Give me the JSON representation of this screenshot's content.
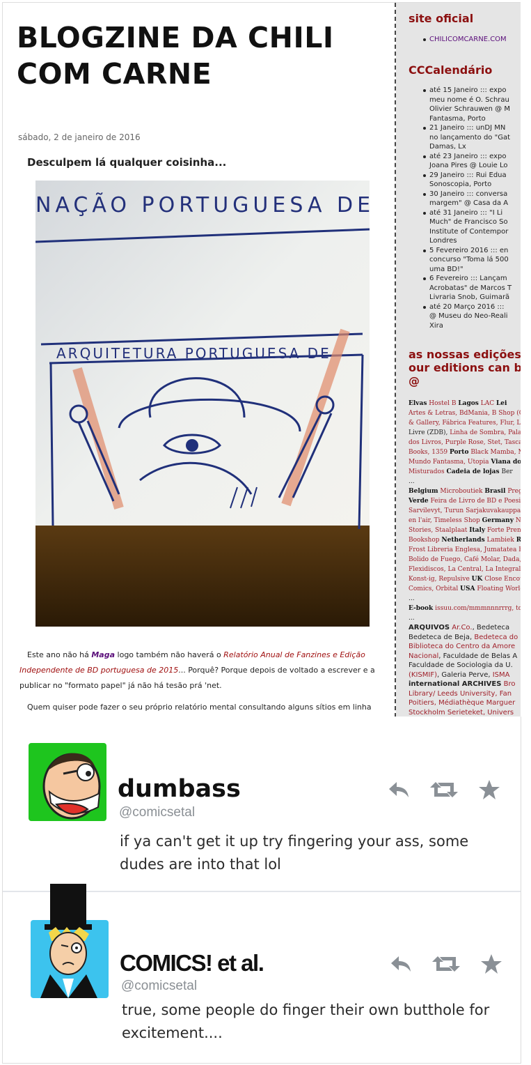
{
  "blog": {
    "title": "BLOGZINE DA CHILI COM CARNE",
    "date": "sábado, 2 de janeiro de 2016",
    "post_title": "Desculpem lá qualquer coisinha...",
    "drawing_text_top": "NAÇÃO PORTUGUESA DE",
    "drawing_text_mid": "ARQUITETURA PORTUGUESA DE",
    "body_p1_a": "Este ano não há ",
    "body_p1_maga": "Maga",
    "body_p1_b": " logo também não haverá o ",
    "body_p1_rel": "Relatório Anual de Fanzines e Edição Independente de BD portuguesa de 2015",
    "body_p1_c": "... Porquê? Porque depois de voltado a escrever e a publicar no \"formato papel\" já não há tesão prá 'net.",
    "body_p2": "Quem quiser pode fazer o seu próprio relatório mental consultando alguns sítios em linha de"
  },
  "sidebar": {
    "site_title": "site oficial",
    "site_link": "CHILICOMCARNE.COM",
    "calendar_title": "CCCalendário",
    "calendar": [
      [
        "até 15 Janeiro ::: expo",
        "meu nome é O. Schrau",
        "Olivier Schrauwen @ M",
        "Fantasma, Porto"
      ],
      [
        "21 Janeiro ::: unDJ MN",
        "no lançamento do \"Gat",
        "Damas, Lx"
      ],
      [
        "até 23 Janeiro ::: expo",
        "Joana Pires @ Louie Lo"
      ],
      [
        "29 Janeiro ::: Rui Edua",
        "Sonoscopia, Porto"
      ],
      [
        "30 Janeiro ::: conversa",
        "margem\" @ Casa da A"
      ],
      [
        "até 31 Janeiro ::: \"I Li",
        "Much\" de Francisco So",
        "Institute of Contempor",
        "Londres"
      ],
      [
        "5 Fevereiro 2016 ::: en",
        "concurso \"Toma lá 500",
        "uma BD!\""
      ],
      [
        "6 Fevereiro ::: Lançam",
        "Acrobatas\" de Marcos T",
        "Livraria Snob, Guimarã"
      ],
      [
        "até 20 Março 2016 :::",
        "@ Museu do Neo-Reali",
        "Xira"
      ]
    ],
    "editions_title": [
      "as nossas edições",
      "our editions can b",
      "@"
    ],
    "shops": [
      [
        [
          "b",
          "Elvas"
        ],
        [
          "s",
          " Hostel B "
        ],
        [
          "b",
          "Lagos"
        ],
        [
          "s",
          " LAC "
        ],
        [
          "b",
          "Lei"
        ]
      ],
      [
        [
          "s",
          "Artes & Letras, BdMania, B Shop (CC"
        ]
      ],
      [
        [
          "s",
          "& Gallery, Fábrica Features, Flur, L"
        ]
      ],
      [
        [
          "n",
          "Livre (ZDB), "
        ],
        [
          "s",
          "Linha de Sombra, Palav"
        ]
      ],
      [
        [
          "s",
          "dos Livros, Purple Rose, Stet, Tasca M"
        ]
      ],
      [
        [
          "s",
          "Books, 1359 "
        ],
        [
          "b",
          "Porto"
        ],
        [
          "s",
          " Black Mamba, Ma"
        ]
      ],
      [
        [
          "s",
          "Mundo Fantasma, Utopia "
        ],
        [
          "b",
          "Viana do C"
        ]
      ],
      [
        [
          "s",
          "Misturados "
        ],
        [
          "b",
          "Cadeia de lojas"
        ],
        [
          "n",
          " Ber"
        ]
      ],
      [
        [
          "n",
          "..."
        ]
      ],
      [
        [
          "b",
          "Belgium"
        ],
        [
          "s",
          " Microboutiek "
        ],
        [
          "b",
          "Brasil"
        ],
        [
          "s",
          " Prego"
        ]
      ],
      [
        [
          "b",
          "Verde"
        ],
        [
          "s",
          " Feira de Livro de BD e Poesia "
        ]
      ],
      [
        [
          "s",
          "Sarvilevyt, Turun Sarjakuvakauppa "
        ],
        [
          "b",
          "Fr"
        ]
      ],
      [
        [
          "s",
          "en l'air, Timeless Shop "
        ],
        [
          "b",
          "Germany"
        ],
        [
          "s",
          " Ne"
        ]
      ],
      [
        [
          "s",
          "Stories, Staalplaat "
        ],
        [
          "b",
          "Italy"
        ],
        [
          "s",
          " Forte Prenes"
        ]
      ],
      [
        [
          "s",
          "Bookshop "
        ],
        [
          "b",
          "Netherlands"
        ],
        [
          "s",
          " Lambiek "
        ],
        [
          "b",
          "Ron"
        ]
      ],
      [
        [
          "s",
          "Frost Libreria Englesa, Jumatatea Plin"
        ]
      ],
      [
        [
          "s",
          "Bolido de Fuego, Café Molar, Dada, F"
        ]
      ],
      [
        [
          "s",
          "Flexidiscos, La Central, La Integral, P"
        ]
      ],
      [
        [
          "s",
          "Konst-ig, Repulsive "
        ],
        [
          "b",
          "UK"
        ],
        [
          "s",
          " Close Encou"
        ]
      ],
      [
        [
          "s",
          "Comics, Orbital "
        ],
        [
          "b",
          "USA"
        ],
        [
          "s",
          " Floating World,"
        ]
      ],
      [
        [
          "n",
          "..."
        ]
      ],
      [
        [
          "b",
          "E-book"
        ],
        [
          "s",
          " issuu.com/mmmnnnrrrg, todo"
        ]
      ],
      [
        [
          "n",
          "..."
        ]
      ]
    ],
    "archives": [
      [
        [
          "b",
          "ARQUIVOS"
        ],
        [
          "r",
          " Ar.Co."
        ],
        [
          "n",
          ", Bedeteca "
        ]
      ],
      [
        [
          "n",
          "Bedeteca de Beja, "
        ],
        [
          "r",
          "Bedeteca do"
        ]
      ],
      [
        [
          "r",
          "Biblioteca do Centro da Amore"
        ]
      ],
      [
        [
          "r",
          "Nacional"
        ],
        [
          "n",
          ", Faculdade de Belas A"
        ]
      ],
      [
        [
          "n",
          "Faculdade de Sociologia da U."
        ]
      ],
      [
        [
          "r",
          "(KISMIF)"
        ],
        [
          "n",
          ", Galeria Perve, "
        ],
        [
          "r",
          "ISMA"
        ]
      ],
      [
        [
          "b",
          "international ARCHIVES"
        ],
        [
          "r",
          " Bro"
        ]
      ],
      [
        [
          "r",
          "Library/ Leeds University, Fan"
        ]
      ],
      [
        [
          "r",
          "Poitiers, Médiathèque Marguer"
        ]
      ],
      [
        [
          "r",
          "Stockholm Serieteket, Univers"
        ]
      ]
    ]
  },
  "tweets": [
    {
      "name": "dumbass",
      "handle": "@comicsetal",
      "text": "if ya can't get it up try fingering your ass, some dudes are into that lol"
    },
    {
      "name": "COMICS! et al.",
      "handle": "@comicsetal",
      "text": "true, some people do finger their own butthole for excitement...."
    }
  ],
  "colors": {
    "sidebar_heading": "#8c1010",
    "link_purple": "#5a0e7a",
    "shop_red": "#a0202a",
    "icon_gray": "#8a9096",
    "handle_gray": "#8a8f94"
  },
  "icons": {
    "reply": "reply-icon",
    "retweet": "retweet-icon",
    "favorite": "star-icon"
  }
}
